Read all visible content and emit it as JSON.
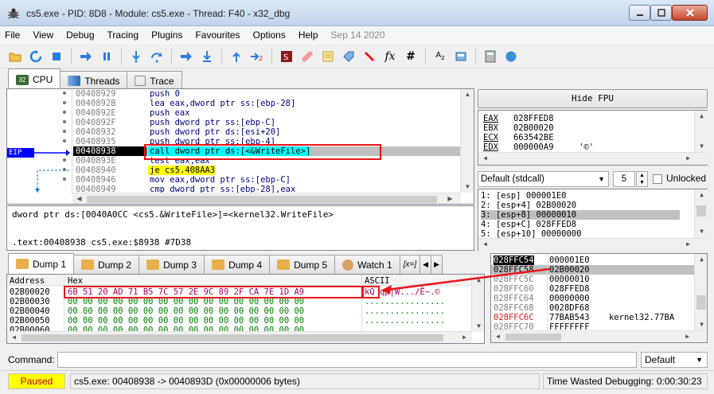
{
  "window": {
    "title": "cs5.exe - PID: 8D8 - Module: cs5.exe - Thread: F40 - x32_dbg",
    "icon": "bug-icon"
  },
  "menu": [
    "File",
    "View",
    "Debug",
    "Tracing",
    "Plugins",
    "Favourites",
    "Options",
    "Help",
    "Sep 14 2020"
  ],
  "toolbar_icons": [
    "open-folder-icon",
    "restart-icon",
    "stop-icon",
    "run-icon",
    "pause-icon",
    "step-into-icon",
    "step-over-icon",
    "trace-into-icon",
    "trace-over-icon",
    "execute-till-return-icon",
    "run-to-user-code-icon",
    "scylla-icon",
    "patch-icon",
    "comment-icon",
    "label-icon",
    "bookmark-icon",
    "function-icon",
    "hash-icon",
    "string-icon",
    "memory-icon",
    "calculator-icon",
    "globe-icon"
  ],
  "top_tabs": [
    "CPU",
    "Threads",
    "Trace"
  ],
  "disassembly": {
    "eip_label": "EIP",
    "rows": [
      {
        "addr": "00408929",
        "instr": "push 0"
      },
      {
        "addr": "0040892B",
        "instr": "lea eax,dword ptr ss:[ebp-28]"
      },
      {
        "addr": "0040892E",
        "instr": "push eax"
      },
      {
        "addr": "0040892F",
        "instr": "push dword ptr ss:[ebp-C]"
      },
      {
        "addr": "00408932",
        "instr": "push dword ptr ds:[esi+20]"
      },
      {
        "addr": "00408935",
        "instr": "push dword ptr ss:[ebp-4]"
      },
      {
        "addr": "00408938",
        "instr": "call dword ptr ds:[<&WriteFile>]"
      },
      {
        "addr": "0040893E",
        "instr": "test eax,eax"
      },
      {
        "addr": "00408940",
        "instr": "je cs5.408AA3"
      },
      {
        "addr": "00408946",
        "instr": "mov eax,dword ptr ss:[ebp-C]"
      },
      {
        "addr": "00408949",
        "instr": "cmp dword ptr ss:[ebp-28],eax"
      }
    ]
  },
  "info": {
    "line1": "dword ptr ds:[0040A0CC <cs5.&WriteFile>]=<kernel32.WriteFile>",
    "line2": ".text:00408938 cs5.exe:$8938 #7D38"
  },
  "fpu_button": "Hide FPU",
  "registers": [
    {
      "name": "EAX",
      "value": "028FFED8",
      "extra": ""
    },
    {
      "name": "EBX",
      "value": "02B00020",
      "extra": ""
    },
    {
      "name": "ECX",
      "value": "663542BE",
      "extra": ""
    },
    {
      "name": "EDX",
      "value": "000000A9",
      "extra": "'©'"
    }
  ],
  "call_convention": {
    "selected": "Default (stdcall)",
    "count": "5",
    "unlocked_label": "Unlocked"
  },
  "stack_args": [
    "1: [esp] 000001E0",
    "2: [esp+4] 02B00020",
    "3: [esp+8] 00000010",
    "4: [esp+C] 028FFED8",
    "5: [esp+10] 00000000"
  ],
  "bottom_tabs": [
    "Dump 1",
    "Dump 2",
    "Dump 3",
    "Dump 4",
    "Dump 5",
    "Watch 1",
    "[x=]"
  ],
  "dump": {
    "headers": {
      "address": "Address",
      "hex": "Hex",
      "ascii": "ASCII"
    },
    "rows": [
      {
        "addr": "02B00020",
        "hex": "6B 51 20 AD 71 B5 7C 57 2E 9C 89 2F CA 7E 1D A9",
        "ascii": "kQ ­qµ|W.../Ê~.©"
      },
      {
        "addr": "02B00030",
        "hex": "00 00 00 00 00 00 00 00 00 00 00 00 00 00 00 00",
        "ascii": "................"
      },
      {
        "addr": "02B00040",
        "hex": "00 00 00 00 00 00 00 00 00 00 00 00 00 00 00 00",
        "ascii": "................"
      },
      {
        "addr": "02B00050",
        "hex": "00 00 00 00 00 00 00 00 00 00 00 00 00 00 00 00",
        "ascii": "................"
      },
      {
        "addr": "02B00060",
        "hex": "00 00 00 00 00 00 00 00 00 00 00 00 00 00 00 00",
        "ascii": "................"
      }
    ]
  },
  "stack": [
    {
      "addr": "028FFC54",
      "value": "000001E0",
      "comment": ""
    },
    {
      "addr": "028FFC58",
      "value": "02B00020",
      "comment": ""
    },
    {
      "addr": "028FFC5C",
      "value": "00000010",
      "comment": ""
    },
    {
      "addr": "028FFC60",
      "value": "028FFED8",
      "comment": ""
    },
    {
      "addr": "028FFC64",
      "value": "00000000",
      "comment": ""
    },
    {
      "addr": "028FFC68",
      "value": "0028DF68",
      "comment": ""
    },
    {
      "addr": "028FFC6C",
      "value": "77BAB543",
      "comment": "kernel32.77BA"
    },
    {
      "addr": "028FFC70",
      "value": "FFFFFFFF",
      "comment": ""
    }
  ],
  "command": {
    "label": "Command:",
    "value": "",
    "mode": "Default"
  },
  "status": {
    "state": "Paused",
    "message": "cs5.exe: 00408938 -> 0040893D (0x00000006 bytes)",
    "time_wasted": "Time Wasted Debugging: 0:00:30:23"
  },
  "colors": {
    "highlight_red": "#e8161b",
    "cyan": "#00ffff",
    "yellow": "#ffff00",
    "eip_blue": "#0000ff"
  }
}
